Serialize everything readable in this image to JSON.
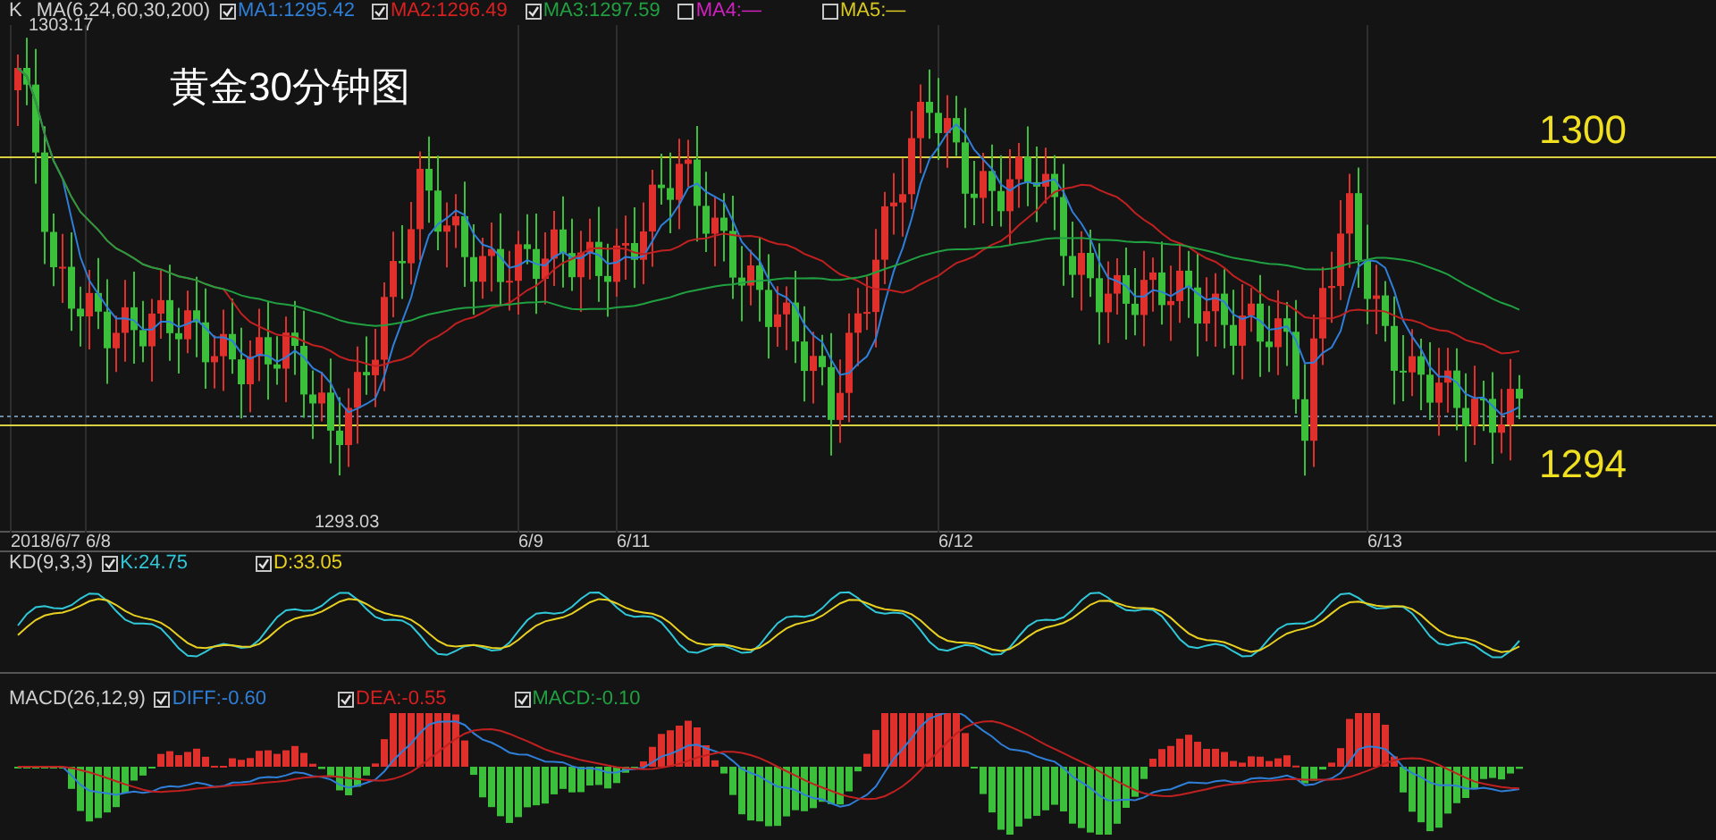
{
  "main_panel": {
    "indicator": "K",
    "params": "MA(6,24,60,30,200)",
    "legend": [
      {
        "label": "MA1:1295.42",
        "checked": true,
        "color": "#2f7fd8"
      },
      {
        "label": "MA2:1296.49",
        "checked": true,
        "color": "#d82020"
      },
      {
        "label": "MA3:1297.59",
        "checked": true,
        "color": "#20a040"
      },
      {
        "label": "MA4:—",
        "checked": false,
        "color": "#d020c0"
      },
      {
        "label": "MA5:—",
        "checked": false,
        "color": "#d8c820"
      }
    ],
    "high_label": "1303.17",
    "title": "黄金30分钟图",
    "levels": [
      "1300",
      "1294"
    ],
    "low_label": "1293.03"
  },
  "date_axis": [
    "2018/6/7",
    "6/8",
    "6/9",
    "6/11",
    "6/12",
    "6/13"
  ],
  "kd_panel": {
    "params": "KD(9,3,3)",
    "legend": [
      {
        "label": "K:24.75",
        "checked": true,
        "color": "#30c8d8"
      },
      {
        "label": "D:33.05",
        "checked": true,
        "color": "#e8d020"
      }
    ]
  },
  "macd_panel": {
    "params": "MACD(26,12,9)",
    "legend": [
      {
        "label": "DIFF:-0.60",
        "checked": true,
        "color": "#2f7fd8"
      },
      {
        "label": "DEA:-0.55",
        "checked": true,
        "color": "#d82020"
      },
      {
        "label": "MACD:-0.10",
        "checked": true,
        "color": "#20a040"
      }
    ]
  }
}
